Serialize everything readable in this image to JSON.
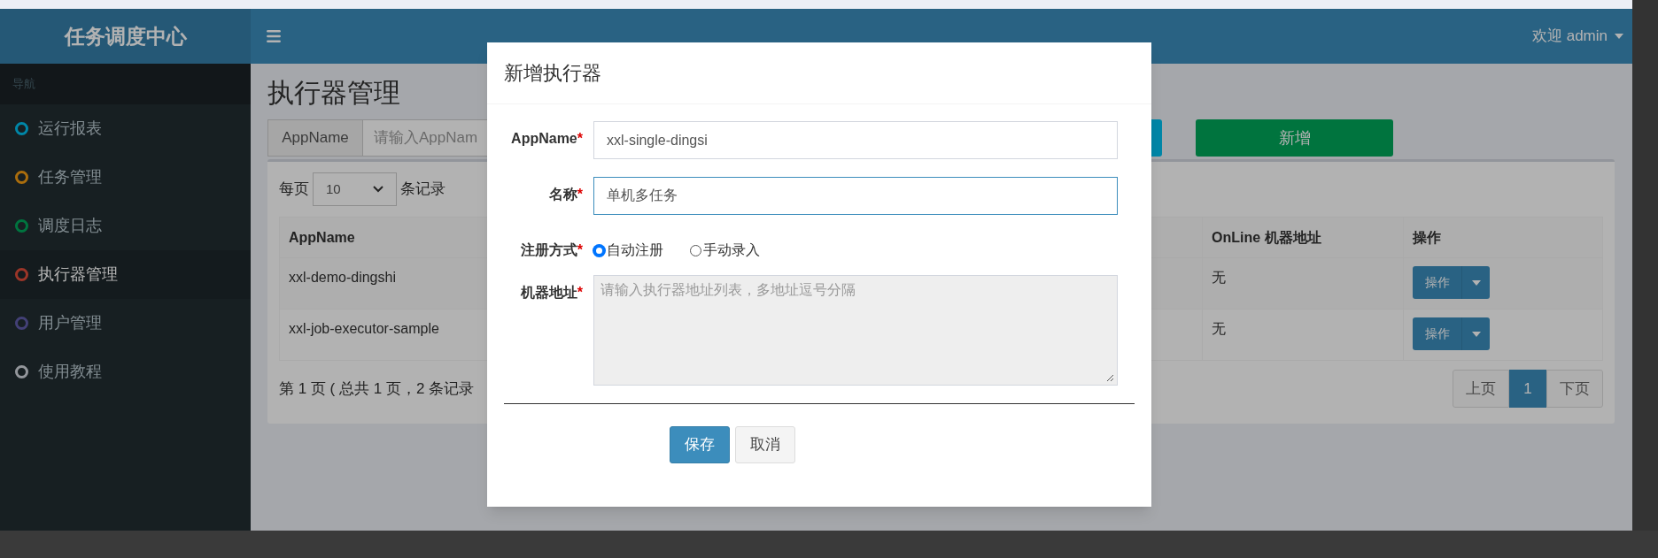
{
  "header": {
    "brand": "任务调度中心",
    "user": "欢迎 admin"
  },
  "sidebar": {
    "heading": "导航",
    "items": [
      {
        "label": "运行报表",
        "color": "#0086a7",
        "selected": false
      },
      {
        "label": "任务管理",
        "color": "#aa6d0d",
        "selected": false
      },
      {
        "label": "调度日志",
        "color": "#00743f",
        "selected": false
      },
      {
        "label": "执行器管理",
        "color": "#9b3528",
        "selected": true
      },
      {
        "label": "用户管理",
        "color": "#434076",
        "selected": false
      },
      {
        "label": "使用教程",
        "color": "#93969b",
        "selected": false
      }
    ]
  },
  "page": {
    "title": "执行器管理",
    "search": {
      "label": "AppName",
      "placeholder": "请输入AppNam"
    },
    "add_button": "新增",
    "page_size": {
      "prefix": "每页",
      "value": "10",
      "suffix": "条记录"
    },
    "table": {
      "columns": [
        "AppName",
        "OnLine 机器地址",
        "操作"
      ],
      "rows": [
        {
          "appname": "xxl-demo-dingshi",
          "online": "无",
          "action": "操作"
        },
        {
          "appname": "xxl-job-executor-sample",
          "online": "无",
          "action": "操作"
        }
      ]
    },
    "summary": "第 1 页 ( 总共 1 页，2 条记录",
    "pagination": [
      {
        "label": "上页",
        "selected": false
      },
      {
        "label": "1",
        "selected": true
      },
      {
        "label": "下页",
        "selected": false
      }
    ]
  },
  "modal": {
    "title": "新增执行器",
    "fields": [
      {
        "kind": "text",
        "label": "AppName",
        "asterisk": "*",
        "value": "xxl-single-dingsi",
        "focused": false
      },
      {
        "kind": "text",
        "label": "名称",
        "asterisk": "*",
        "value": "单机多任务",
        "focused": true
      },
      {
        "kind": "radio",
        "label": "注册方式",
        "asterisk": "*",
        "options": [
          {
            "label": "自动注册",
            "selected": true
          },
          {
            "label": "手动录入",
            "selected": false
          }
        ]
      },
      {
        "kind": "textarea",
        "label": "机器地址",
        "asterisk": "*",
        "placeholder": "请输入执行器地址列表，多地址逗号分隔"
      }
    ],
    "buttons": [
      {
        "label": "保存",
        "kind": "primary"
      },
      {
        "label": "取消",
        "kind": "default"
      }
    ]
  }
}
